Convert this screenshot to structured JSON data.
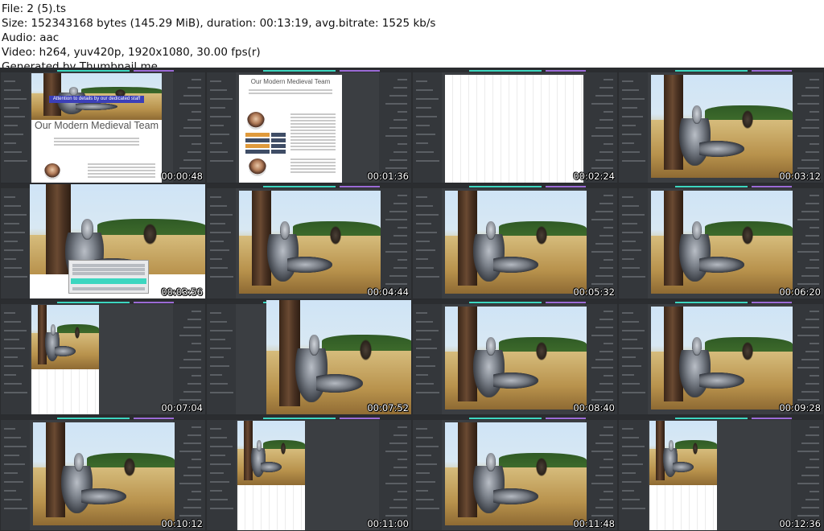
{
  "header": {
    "file": "File: 2 (5).ts",
    "size": "Size: 152343168 bytes (145.29 MiB), duration: 00:13:19, avg.bitrate: 1525 kb/s",
    "audio": "Audio: aac",
    "video": "Video: h264, yuv420p, 1920x1080, 30.00 fps(r)",
    "generator": "Generated by Thumbnail me"
  },
  "mockup": {
    "title": "Our Modern Medieval Team",
    "banner": "Attention to details by our dedicated staff"
  },
  "colors": {
    "editor_bg": "#3b3e42",
    "panel_bg": "#34373b",
    "accent_teal": "#3dd6c0",
    "accent_purple": "#9b6bd6",
    "banner_blue": "#3b3fb8"
  },
  "thumbnails": [
    {
      "time": "00:00:48",
      "kind": "mockup-a"
    },
    {
      "time": "00:01:36",
      "kind": "mockup-b"
    },
    {
      "time": "00:02:24",
      "kind": "blank"
    },
    {
      "time": "00:03:12",
      "kind": "photo"
    },
    {
      "time": "00:03:56",
      "kind": "photo-dialog"
    },
    {
      "time": "00:04:44",
      "kind": "photo"
    },
    {
      "time": "00:05:32",
      "kind": "photo"
    },
    {
      "time": "00:06:20",
      "kind": "photo"
    },
    {
      "time": "00:07:04",
      "kind": "photo-small"
    },
    {
      "time": "00:07:52",
      "kind": "photo-wide"
    },
    {
      "time": "00:08:40",
      "kind": "photo"
    },
    {
      "time": "00:09:28",
      "kind": "photo"
    },
    {
      "time": "00:10:12",
      "kind": "photo"
    },
    {
      "time": "00:11:00",
      "kind": "photo-small"
    },
    {
      "time": "00:11:48",
      "kind": "photo"
    },
    {
      "time": "00:12:36",
      "kind": "photo-small"
    }
  ]
}
